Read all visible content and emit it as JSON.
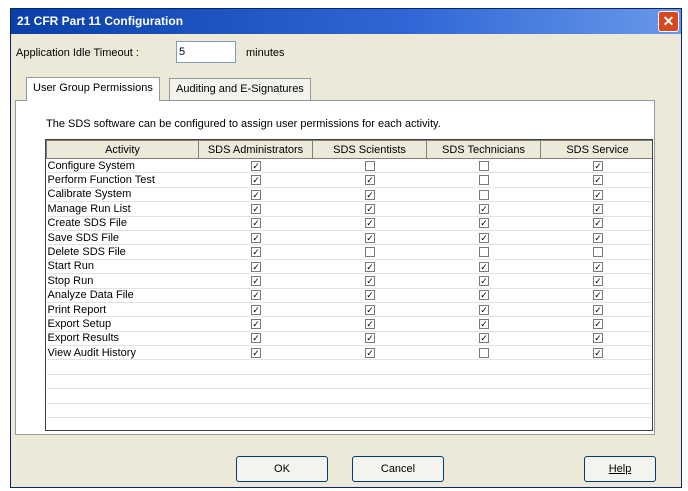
{
  "window": {
    "title": "21 CFR Part 11 Configuration",
    "close_glyph": "✕"
  },
  "idle": {
    "label": "Application Idle Timeout :",
    "value": "5",
    "unit": "minutes"
  },
  "tabs": [
    {
      "label": "User Group Permissions",
      "active": true
    },
    {
      "label": "Auditing and E-Signatures",
      "active": false
    }
  ],
  "description": "The SDS software can be configured to assign user permissions for each activity.",
  "grid": {
    "columns": [
      "Activity",
      "SDS Administrators",
      "SDS Scientists",
      "SDS Technicians",
      "SDS Service"
    ],
    "rows": [
      {
        "activity": "Configure System",
        "checks": [
          true,
          false,
          false,
          true
        ]
      },
      {
        "activity": "Perform Function Test",
        "checks": [
          true,
          true,
          false,
          true
        ]
      },
      {
        "activity": "Calibrate System",
        "checks": [
          true,
          true,
          false,
          true
        ]
      },
      {
        "activity": "Manage Run List",
        "checks": [
          true,
          true,
          true,
          true
        ]
      },
      {
        "activity": "Create SDS File",
        "checks": [
          true,
          true,
          true,
          true
        ]
      },
      {
        "activity": "Save SDS File",
        "checks": [
          true,
          true,
          true,
          true
        ]
      },
      {
        "activity": "Delete SDS File",
        "checks": [
          true,
          false,
          false,
          false
        ]
      },
      {
        "activity": "Start Run",
        "checks": [
          true,
          true,
          true,
          true
        ]
      },
      {
        "activity": "Stop Run",
        "checks": [
          true,
          true,
          true,
          true
        ]
      },
      {
        "activity": "Analyze Data File",
        "checks": [
          true,
          true,
          true,
          true
        ]
      },
      {
        "activity": "Print Report",
        "checks": [
          true,
          true,
          true,
          true
        ]
      },
      {
        "activity": "Export Setup",
        "checks": [
          true,
          true,
          true,
          true
        ]
      },
      {
        "activity": "Export Results",
        "checks": [
          true,
          true,
          true,
          true
        ]
      },
      {
        "activity": "View Audit History",
        "checks": [
          true,
          true,
          false,
          true
        ]
      }
    ],
    "check_glyph": "✓"
  },
  "buttons": {
    "ok": "OK",
    "cancel": "Cancel",
    "help": "Help"
  }
}
